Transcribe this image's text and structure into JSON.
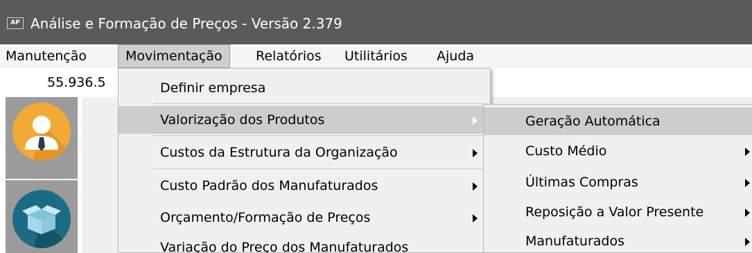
{
  "window": {
    "app_icon_text": "AP",
    "title": "Análise e Formação de Preços - Versão 2.379"
  },
  "menubar": {
    "items": [
      {
        "label": "Manutenção"
      },
      {
        "label": "Movimentação"
      },
      {
        "label": "Relatórios"
      },
      {
        "label": "Utilitários"
      },
      {
        "label": "Ajuda"
      }
    ]
  },
  "value_row": {
    "value": "55.936.5"
  },
  "left_icons": [
    "user-icon",
    "box-icon"
  ],
  "dropdown": {
    "items": [
      {
        "label": "Definir empresa"
      },
      {
        "label": "Valorização dos Produtos"
      },
      {
        "label": "Custos da Estrutura da Organização"
      },
      {
        "label": "Custo Padrão dos Manufaturados"
      },
      {
        "label": "Orçamento/Formação de Preços"
      },
      {
        "label": "Variação do Preço dos Manufaturados"
      }
    ]
  },
  "submenu": {
    "items": [
      {
        "label": "Geração Automática"
      },
      {
        "label": "Custo Médio"
      },
      {
        "label": "Últimas Compras"
      },
      {
        "label": "Reposição a Valor Presente"
      },
      {
        "label": "Manufaturados"
      }
    ]
  },
  "colors": {
    "titlebar": "#5a5a5a",
    "highlight": "#cdcdcd",
    "user_icon": "#f3a935",
    "box_icon": "#1c6b85"
  }
}
